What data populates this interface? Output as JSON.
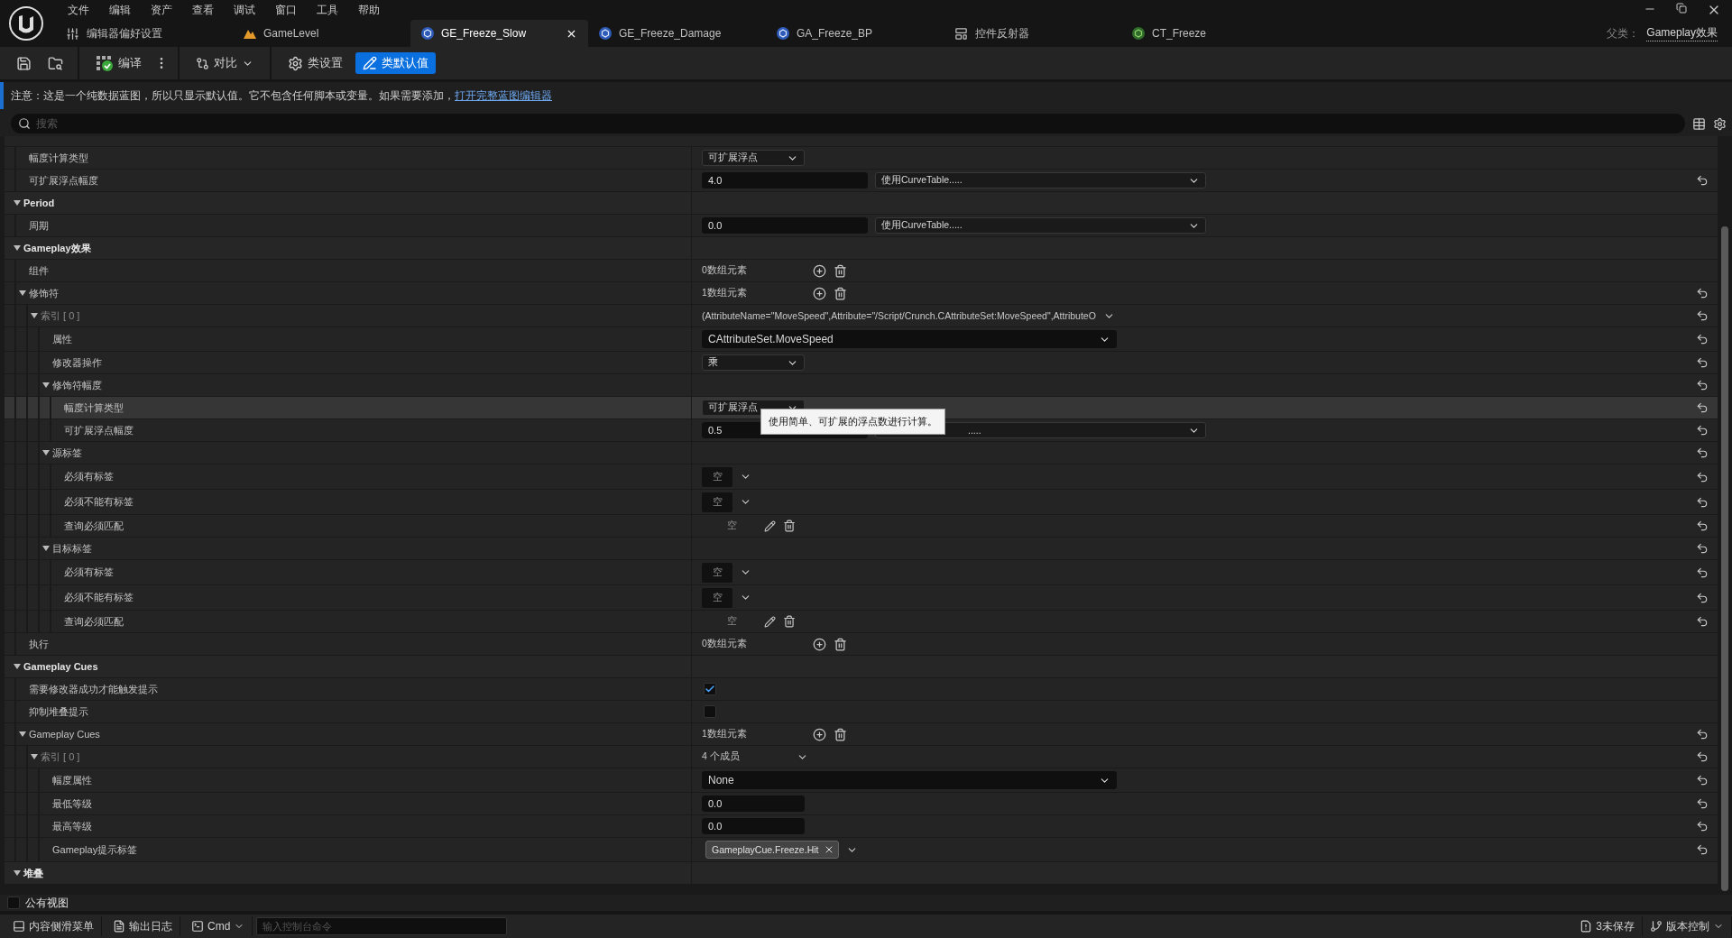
{
  "menu": [
    "文件",
    "编辑",
    "资产",
    "查看",
    "调试",
    "窗口",
    "工具",
    "帮助"
  ],
  "tabs": [
    {
      "label": "编辑器偏好设置",
      "kind": "settings",
      "selected": false
    },
    {
      "label": "GameLevel",
      "kind": "level",
      "selected": false
    },
    {
      "label": "GE_Freeze_Slow",
      "kind": "blueprint",
      "selected": true
    },
    {
      "label": "GE_Freeze_Damage",
      "kind": "blueprint",
      "selected": false
    },
    {
      "label": "GA_Freeze_BP",
      "kind": "blueprint",
      "selected": false
    },
    {
      "label": "控件反射器",
      "kind": "reflector",
      "selected": false
    },
    {
      "label": "CT_Freeze",
      "kind": "curvetable",
      "selected": false
    }
  ],
  "parent_class": {
    "label": "父类：",
    "value": "Gameplay效果"
  },
  "toolbar": {
    "compile": "编译",
    "diff": "对比",
    "modes": [
      {
        "label": "类设置",
        "kind": "settings",
        "selected": false
      },
      {
        "label": "类默认值",
        "kind": "defaults",
        "selected": true
      }
    ]
  },
  "notice": {
    "text": "注意：这是一个纯数据蓝图，所以只显示默认值。它不包含任何脚本或变量。如果需要添加，",
    "link": "打开完整蓝图编辑器"
  },
  "search": {
    "placeholder": "搜索"
  },
  "details": [
    {
      "kind": "category",
      "expanded": true,
      "children": [
        {
          "kind": "property",
          "label": "幅度计算类型",
          "reset": false,
          "value": {
            "kind": "combo",
            "text": "可扩展浮点"
          }
        },
        {
          "kind": "property",
          "label": "可扩展浮点幅度",
          "reset": true,
          "value": {
            "kind": "float_curve",
            "number": "4.0",
            "curve": "使用CurveTable....."
          }
        }
      ]
    },
    {
      "kind": "category",
      "label": "Period",
      "expanded": true,
      "children": [
        {
          "kind": "property",
          "label": "周期",
          "reset": false,
          "value": {
            "kind": "float_curve",
            "number": "0.0",
            "curve": "使用CurveTable....."
          }
        }
      ]
    },
    {
      "kind": "category",
      "label": "Gameplay效果",
      "expanded": true,
      "children": [
        {
          "kind": "property",
          "label": "组件",
          "reset": false,
          "value": {
            "kind": "array",
            "text": "0数组元素"
          }
        },
        {
          "kind": "property",
          "label": "修饰符",
          "reset": true,
          "expanded": true,
          "value": {
            "kind": "array",
            "text": "1数组元素"
          },
          "children": [
            {
              "kind": "index",
              "label": "索引 [ 0 ]",
              "reset": true,
              "expanded": true,
              "value": {
                "kind": "struct",
                "text": "(AttributeName=\"MoveSpeed\",Attribute=\"/Script/Crunch.CAttributeSet:MoveSpeed\",AttributeO"
              },
              "children": [
                {
                  "kind": "property",
                  "label": "属性",
                  "reset": true,
                  "value": {
                    "kind": "wide_combo",
                    "text": "CAttributeSet.MoveSpeed"
                  }
                },
                {
                  "kind": "property",
                  "label": "修改器操作",
                  "reset": true,
                  "value": {
                    "kind": "combo",
                    "text": "乘"
                  }
                },
                {
                  "kind": "property",
                  "label": "修饰符幅度",
                  "reset": true,
                  "expanded": true,
                  "children": [
                    {
                      "kind": "property",
                      "label": "幅度计算类型",
                      "reset": true,
                      "hovered": true,
                      "value": {
                        "kind": "combo",
                        "text": "可扩展浮点"
                      },
                      "tooltip": "使用简单、可扩展的浮点数进行计算。"
                    },
                    {
                      "kind": "property",
                      "label": "可扩展浮点幅度",
                      "reset": true,
                      "value": {
                        "kind": "float_curve",
                        "number": "0.5",
                        "curve": "....."
                      }
                    }
                  ]
                },
                {
                  "kind": "property",
                  "label": "源标签",
                  "reset": true,
                  "expanded": true,
                  "children": [
                    {
                      "kind": "property",
                      "label": "必须有标签",
                      "reset": true,
                      "value": {
                        "kind": "tag",
                        "text": "空"
                      }
                    },
                    {
                      "kind": "property",
                      "label": "必须不能有标签",
                      "reset": true,
                      "value": {
                        "kind": "tag",
                        "text": "空"
                      }
                    },
                    {
                      "kind": "property",
                      "label": "查询必须匹配",
                      "reset": true,
                      "value": {
                        "kind": "query",
                        "text": "空"
                      }
                    }
                  ]
                },
                {
                  "kind": "property",
                  "label": "目标标签",
                  "reset": true,
                  "expanded": true,
                  "children": [
                    {
                      "kind": "property",
                      "label": "必须有标签",
                      "reset": true,
                      "value": {
                        "kind": "tag",
                        "text": "空"
                      }
                    },
                    {
                      "kind": "property",
                      "label": "必须不能有标签",
                      "reset": true,
                      "value": {
                        "kind": "tag",
                        "text": "空"
                      }
                    },
                    {
                      "kind": "property",
                      "label": "查询必须匹配",
                      "reset": true,
                      "value": {
                        "kind": "query",
                        "text": "空"
                      }
                    }
                  ]
                }
              ]
            }
          ]
        },
        {
          "kind": "property",
          "label": "执行",
          "reset": false,
          "value": {
            "kind": "array",
            "text": "0数组元素"
          }
        }
      ]
    },
    {
      "kind": "category",
      "label": "Gameplay Cues",
      "expanded": true,
      "children": [
        {
          "kind": "property",
          "label": "需要修改器成功才能触发提示",
          "reset": false,
          "value": {
            "kind": "check",
            "checked": true
          }
        },
        {
          "kind": "property",
          "label": "抑制堆叠提示",
          "reset": false,
          "value": {
            "kind": "check",
            "checked": false
          }
        },
        {
          "kind": "property",
          "label": "Gameplay Cues",
          "reset": true,
          "expanded": true,
          "value": {
            "kind": "array",
            "text": "1数组元素"
          },
          "children": [
            {
              "kind": "index",
              "label": "索引 [ 0 ]",
              "reset": true,
              "expanded": true,
              "value": {
                "kind": "members",
                "text": "4 个成员"
              },
              "children": [
                {
                  "kind": "property",
                  "label": "幅度属性",
                  "reset": true,
                  "value": {
                    "kind": "wide_combo",
                    "text": "None"
                  }
                },
                {
                  "kind": "property",
                  "label": "最低等级",
                  "reset": true,
                  "value": {
                    "kind": "number",
                    "number": "0.0"
                  }
                },
                {
                  "kind": "property",
                  "label": "最高等级",
                  "reset": true,
                  "value": {
                    "kind": "number",
                    "number": "0.0"
                  }
                },
                {
                  "kind": "property",
                  "label": "Gameplay提示标签",
                  "reset": true,
                  "value": {
                    "kind": "chip",
                    "text": "GameplayCue.Freeze.Hit"
                  }
                }
              ]
            }
          ]
        }
      ]
    },
    {
      "kind": "category",
      "label": "堆叠",
      "expanded": true
    }
  ],
  "public_view": {
    "label": "公有视图",
    "checked": false
  },
  "status_bar": {
    "left": [
      {
        "label": "内容侧滑菜单",
        "kind": "drawer"
      },
      {
        "label": "输出日志",
        "kind": "log"
      }
    ],
    "cmd": "Cmd",
    "console": {
      "placeholder": "输入控制台命令"
    },
    "right": [
      {
        "label": "3未保存",
        "kind": "unsaved"
      },
      {
        "label": "版本控制",
        "kind": "source_control"
      }
    ]
  }
}
